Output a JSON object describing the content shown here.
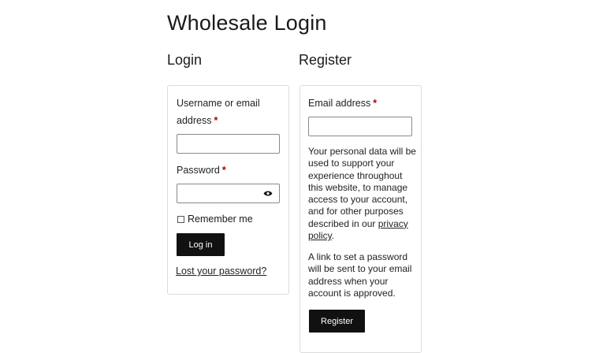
{
  "page": {
    "title": "Wholesale Login"
  },
  "login": {
    "heading": "Login",
    "username_label": "Username or email address",
    "required_mark": "*",
    "password_label": "Password",
    "remember_label": "Remember me",
    "submit_label": "Log in",
    "lost_password_label": "Lost your password?",
    "password_toggle_icon": "eye-icon"
  },
  "register": {
    "heading": "Register",
    "email_label": "Email address",
    "required_mark": "*",
    "privacy_text": "Your personal data will be used to support your experience throughout this website, to manage access to your account, and for other purposes described in our",
    "privacy_link": "privacy policy",
    "privacy_suffix": ".",
    "password_note": "A link to set a password will be sent to your email address when your account is approved.",
    "submit_label": "Register"
  },
  "colors": {
    "button_bg": "#111111",
    "required": "#b00000",
    "card_border": "#dcdcdc"
  }
}
